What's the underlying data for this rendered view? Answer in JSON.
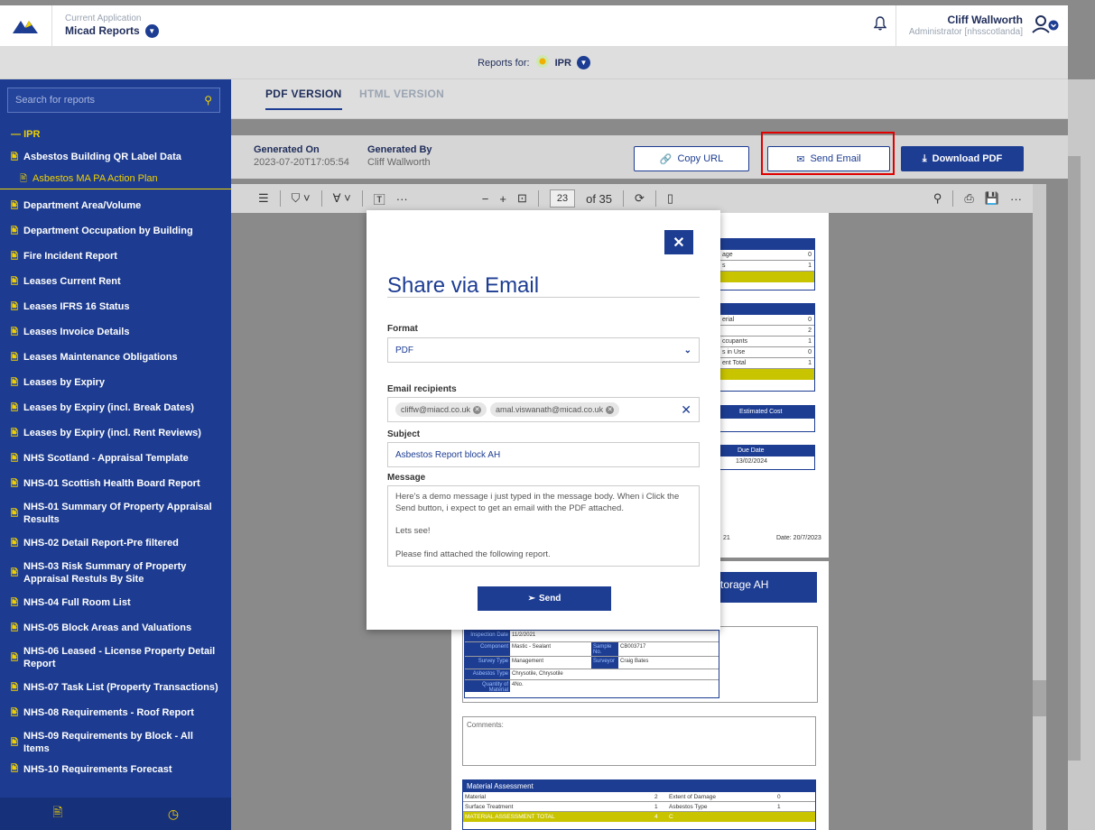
{
  "topbar": {
    "app_caption": "Current Application",
    "app_name": "Micad Reports",
    "user_name": "Cliff Wallworth",
    "user_role": "Administrator [nhsscotlanda]"
  },
  "reports_bar": {
    "label": "Reports for:",
    "value": "IPR"
  },
  "sidebar": {
    "search_placeholder": "Search for reports",
    "group": "IPR",
    "items": [
      {
        "label": "Asbestos Building QR Label Data"
      },
      {
        "label": "Asbestos MA PA Action Plan"
      },
      {
        "label": "Department Area/Volume"
      },
      {
        "label": "Department Occupation by Building"
      },
      {
        "label": "Fire Incident Report"
      },
      {
        "label": "Leases Current Rent"
      },
      {
        "label": "Leases IFRS 16 Status"
      },
      {
        "label": "Leases Invoice Details"
      },
      {
        "label": "Leases Maintenance Obligations"
      },
      {
        "label": "Leases by Expiry"
      },
      {
        "label": "Leases by Expiry (incl. Break Dates)"
      },
      {
        "label": "Leases by Expiry (incl. Rent Reviews)"
      },
      {
        "label": "NHS Scotland - Appraisal Template"
      },
      {
        "label": "NHS-01 Scottish Health Board Report"
      },
      {
        "label": "NHS-01 Summary Of Property Appraisal Results"
      },
      {
        "label": "NHS-02 Detail Report-Pre filtered"
      },
      {
        "label": "NHS-03 Risk Summary of Property Appraisal Restuls By Site"
      },
      {
        "label": "NHS-04 Full Room List"
      },
      {
        "label": "NHS-05 Block Areas and Valuations"
      },
      {
        "label": "NHS-06 Leased - License Property Detail Report"
      },
      {
        "label": "NHS-07 Task List (Property Transactions)"
      },
      {
        "label": "NHS-08 Requirements - Roof Report"
      },
      {
        "label": "NHS-09 Requirements by Block - All Items"
      },
      {
        "label": "NHS-10 Requirements Forecast"
      }
    ]
  },
  "tabs": [
    {
      "label": "PDF VERSION"
    },
    {
      "label": "HTML VERSION"
    }
  ],
  "info": {
    "generated_on_label": "Generated On",
    "generated_on": "2023-07-20T17:05:54",
    "generated_by_label": "Generated By",
    "generated_by": "Cliff Wallworth",
    "copy_url": "Copy URL",
    "send_email": "Send Email",
    "download_pdf": "Download PDF"
  },
  "pdf_toolbar": {
    "page": "23",
    "of": "of 35"
  },
  "pdf_page": {
    "fragments": {
      "a1": "age",
      "a2": "0",
      "a3": "s",
      "a4": "1",
      "b1": "erial",
      "b2": "0",
      "b3": "2",
      "b4": "ccupants",
      "b5": "1",
      "b6": "s in Use",
      "b7": "0",
      "b8": "ent Total",
      "b9": "1",
      "c1": "Estimated Cost",
      "d1": "Due Date",
      "d2": "13/02/2024",
      "date_frag1": "21",
      "date_frag2": "Date: 20/7/2023",
      "storage": "torage AH"
    },
    "inspection": {
      "inspection_date_label": "Inspection Date",
      "inspection_date": "11/2/2021",
      "component_label": "Component",
      "component": "Mastic - Sealant",
      "sample_label": "Sample No.",
      "sample": "CB003717",
      "survey_type_label": "Survey Type",
      "survey_type": "Management",
      "surveyor_label": "Surveyor",
      "surveyor": "Craig Bates",
      "asbestos_type_label": "Asbestos Type",
      "asbestos_type": "Chrysotile, Chrysotile",
      "quantity_label": "Quantity of Material",
      "quantity": "4No."
    },
    "comments_label": "Comments:",
    "material_assessment": {
      "title": "Material Assessment",
      "row1_label": "Material",
      "row1_val": "2",
      "row1_label2": "Extent of Damage",
      "row1_val2": "0",
      "row2_label": "Surface Treatment",
      "row2_val": "1",
      "row2_label2": "Asbestos Type",
      "row2_val2": "1",
      "total_label": "MATERIAL ASSESSMENT TOTAL",
      "total_val": "4",
      "total_grade": "C"
    }
  },
  "modal": {
    "title": "Share via Email",
    "format_label": "Format",
    "format_value": "PDF",
    "recipients_label": "Email recipients",
    "recipients": [
      "cliffw@miacd.co.uk",
      "amal.viswanath@micad.co.uk"
    ],
    "subject_label": "Subject",
    "subject_value": "Asbestos Report block AH",
    "message_label": "Message",
    "message_value": "Here's a demo message i just typed in the message body. When i Click the Send button, i expect to get an email with the PDF attached.\n\nLets see!\n\nPlease find attached the following report.",
    "send_label": "Send"
  },
  "colors": {
    "primary": "#1d3d93",
    "accent": "#f0d000",
    "highlight": "#e00000"
  }
}
